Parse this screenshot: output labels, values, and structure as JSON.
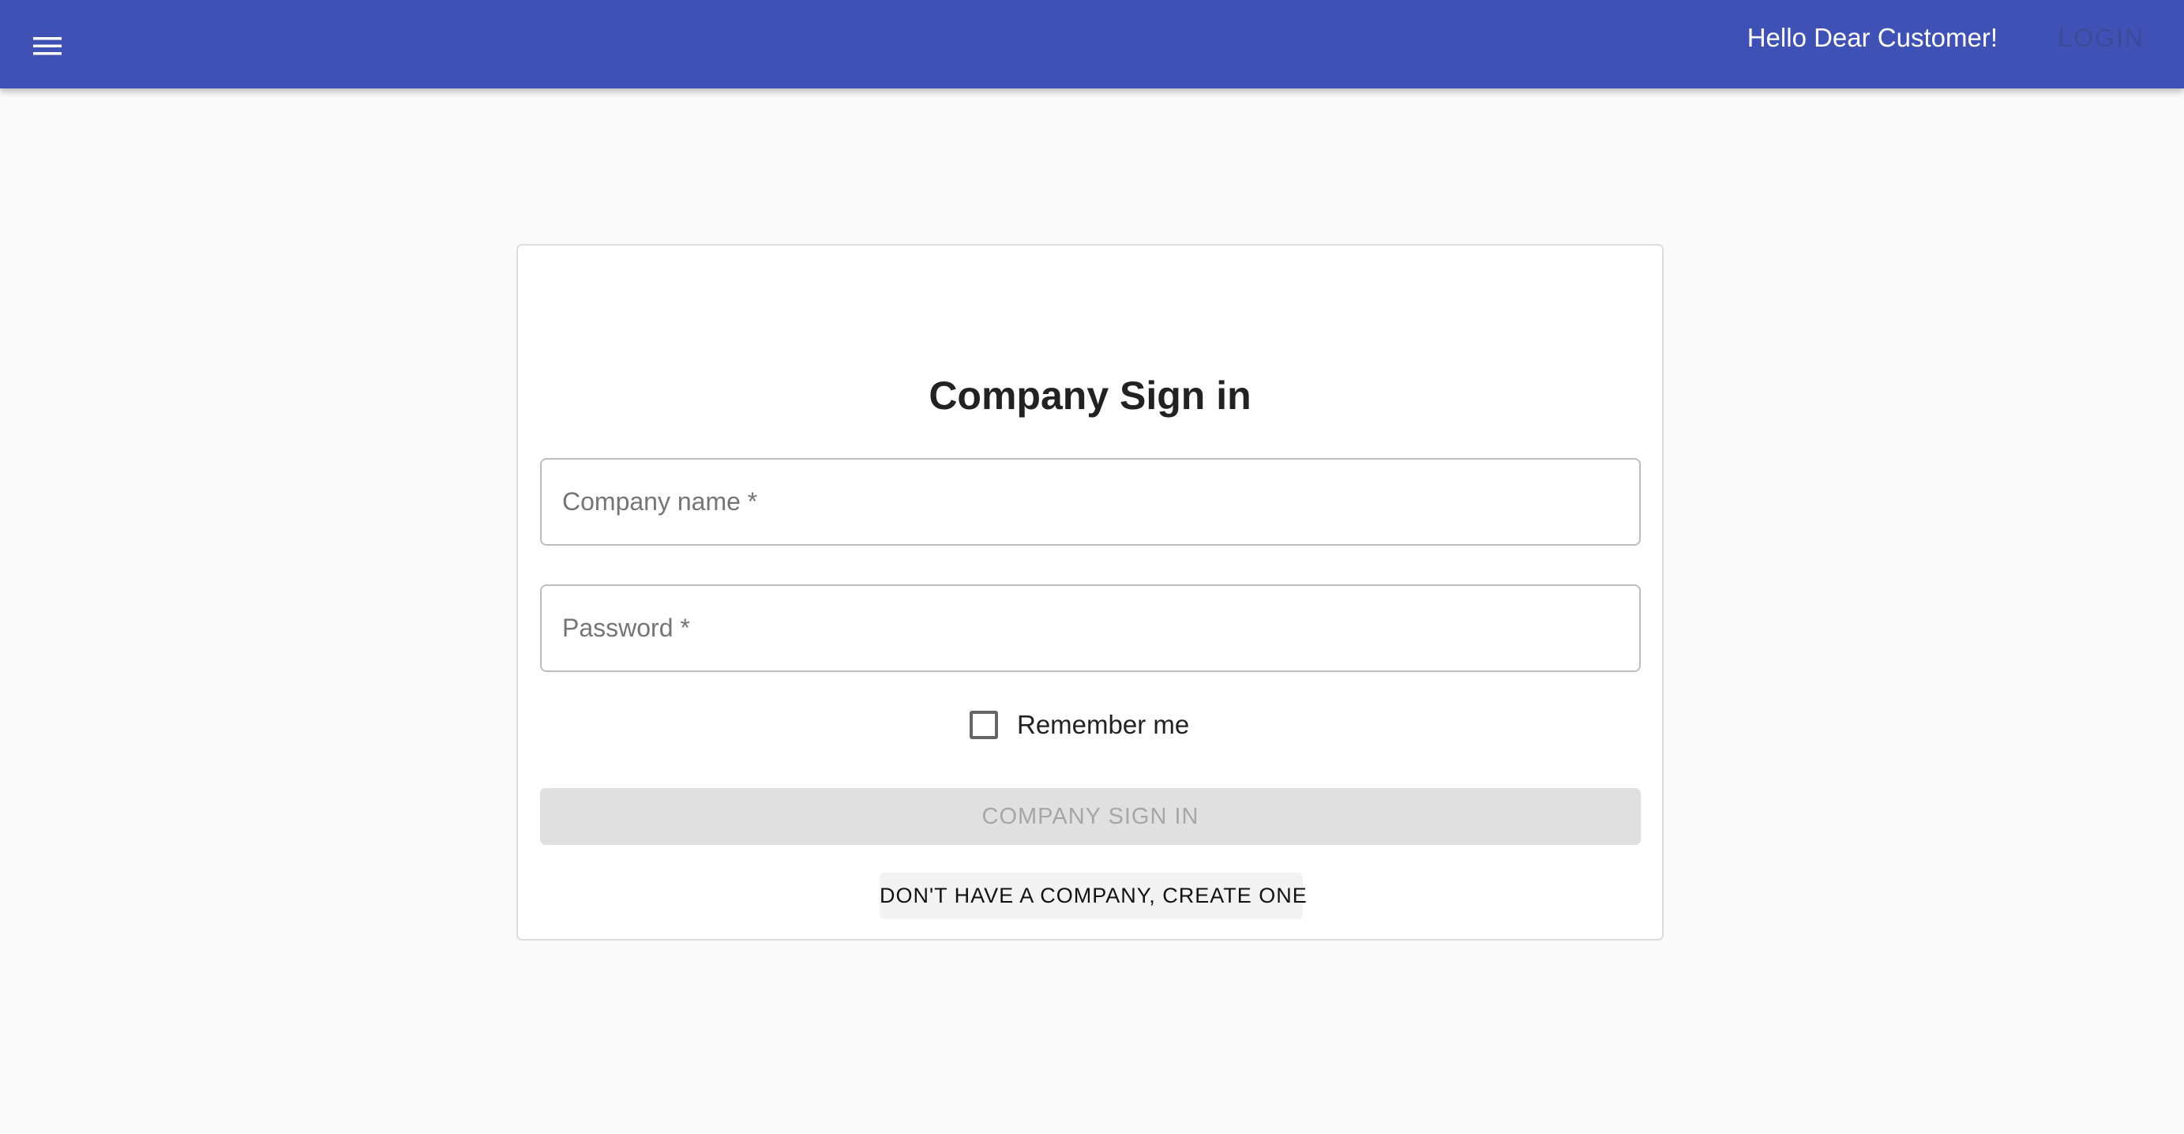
{
  "header": {
    "menu_icon": "hamburger-menu-icon",
    "greeting": "Hello Dear Customer!",
    "login_label": "LOGIN",
    "bar_color": "#3f51b5"
  },
  "form": {
    "title": "Company Sign in",
    "company_name": {
      "placeholder": "Company name *",
      "value": ""
    },
    "password": {
      "placeholder": "Password *",
      "value": ""
    },
    "remember_me": {
      "label": "Remember me",
      "checked": false
    },
    "submit_label": "COMPANY SIGN IN",
    "create_label": "DON'T HAVE A COMPANY, CREATE ONE"
  }
}
